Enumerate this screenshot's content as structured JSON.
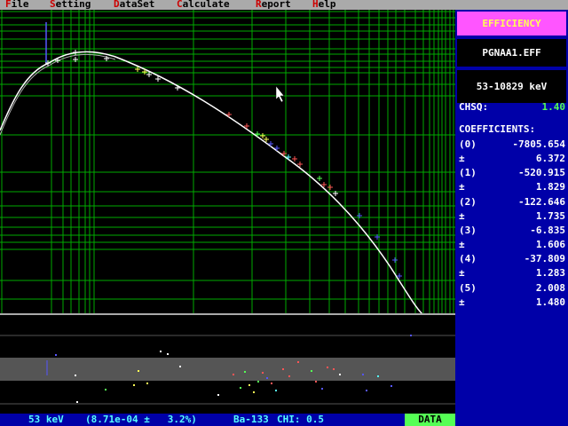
{
  "menu": [
    {
      "hotkey": "F",
      "rest": "ile"
    },
    {
      "hotkey": "S",
      "rest": "etting"
    },
    {
      "hotkey": "D",
      "rest": "ataSet"
    },
    {
      "hotkey": "C",
      "rest": "alculate"
    },
    {
      "hotkey": "R",
      "rest": "eport"
    },
    {
      "hotkey": "H",
      "rest": "elp"
    }
  ],
  "side": {
    "title": "EFFICIENCY",
    "file": "PGNAA1.EFF",
    "range": "53-10829 keV",
    "chsq_label": "CHSQ:",
    "chsq_value": "1.40",
    "coef_header": "COEFFICIENTS:",
    "coefficients": [
      {
        "label": "(0)",
        "value": "-7805.654",
        "err_label": "±",
        "err": "6.372"
      },
      {
        "label": "(1)",
        "value": "-520.915",
        "err_label": "±",
        "err": "1.829"
      },
      {
        "label": "(2)",
        "value": "-122.646",
        "err_label": "±",
        "err": "1.735"
      },
      {
        "label": "(3)",
        "value": "-6.835",
        "err_label": "±",
        "err": "1.606"
      },
      {
        "label": "(4)",
        "value": "-37.809",
        "err_label": "±",
        "err": "1.283"
      },
      {
        "label": "(5)",
        "value": "2.008",
        "err_label": "±",
        "err": "1.480"
      }
    ]
  },
  "status": {
    "energy": "53 keV",
    "efficiency": "(8.71e-04 ±   3.2%)",
    "source": "Ba-133",
    "chi": "CHI: 0.5",
    "data_button": "DATA"
  },
  "colors": {
    "menubar_bg": "#aaaaaa",
    "hotkey": "#cc0000",
    "grid": "#00aa00",
    "panel_blue": "#0000a8",
    "title_bg": "#ff55ff",
    "title_fg": "#ffff55",
    "chsq_value": "#55ff55",
    "status_text": "#55ffff",
    "data_button_bg": "#55ff55",
    "residual_band": "#555555"
  }
}
